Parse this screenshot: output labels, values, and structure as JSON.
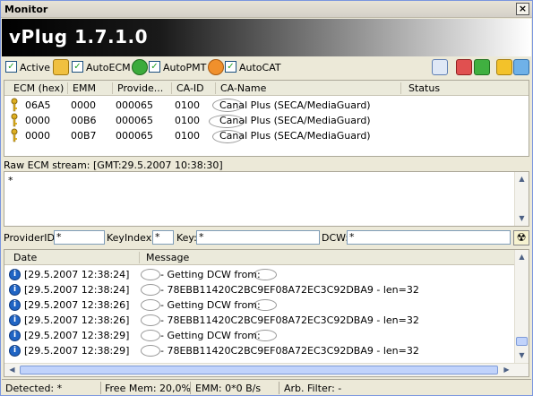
{
  "window": {
    "title": "Monitor",
    "close_label": "×"
  },
  "banner": {
    "title": "vPlug 1.7.1.0"
  },
  "toolbar": {
    "active_label": "Active",
    "autoecm_label": "AutoECM",
    "autopmt_label": "AutoPMT",
    "autocat_label": "AutoCAT",
    "check_glyph": "✓"
  },
  "ecm_table": {
    "columns": [
      "ECM (hex)",
      "EMM",
      "Provide...",
      "CA-ID",
      "CA-Name",
      "Status"
    ],
    "rows": [
      {
        "ecm": "06A5",
        "emm": "0000",
        "provider": "000065",
        "caid": "0100",
        "caname": "Canal Plus (SECA/MediaGuard)",
        "status": ""
      },
      {
        "ecm": "0000",
        "emm": "00B6",
        "provider": "000065",
        "caid": "0100",
        "caname": "Canal Plus (SECA/MediaGuard)",
        "status": ""
      },
      {
        "ecm": "0000",
        "emm": "00B7",
        "provider": "000065",
        "caid": "0100",
        "caname": "Canal Plus (SECA/MediaGuard)",
        "status": ""
      }
    ]
  },
  "raw_ecm": {
    "label": "Raw ECM stream: [GMT:29.5.2007 10:38:30]",
    "content": "*"
  },
  "fields": {
    "provider_label": "ProviderID:",
    "provider_value": "*",
    "keyindex_label": "KeyIndex:",
    "keyindex_value": "*",
    "key_label": "Key:",
    "key_value": "*",
    "dcw_label": "DCW:",
    "dcw_value": "*"
  },
  "log": {
    "columns": [
      "Date",
      "Message"
    ],
    "rows": [
      {
        "date": "[29.5.2007 12:38:24]",
        "message": "- Getting DCW from:"
      },
      {
        "date": "[29.5.2007 12:38:24]",
        "message": "- 78EBB11420C2BC9EF08A72EC3C92DBA9 - len=32"
      },
      {
        "date": "[29.5.2007 12:38:26]",
        "message": "- Getting DCW from:"
      },
      {
        "date": "[29.5.2007 12:38:26]",
        "message": "- 78EBB11420C2BC9EF08A72EC3C92DBA9 - len=32"
      },
      {
        "date": "[29.5.2007 12:38:29]",
        "message": "- Getting DCW from:"
      },
      {
        "date": "[29.5.2007 12:38:29]",
        "message": "- 78EBB11420C2BC9EF08A72EC3C92DBA9 - len=32"
      }
    ]
  },
  "statusbar": {
    "detected": "Detected: *",
    "freemem": "Free Mem: 20,0%",
    "emm": "EMM: 0*0 B/s",
    "arb": "Arb. Filter: -"
  },
  "colors": {
    "selection": "#316ac5",
    "banner_start": "#000000",
    "banner_end": "#ffffff"
  }
}
